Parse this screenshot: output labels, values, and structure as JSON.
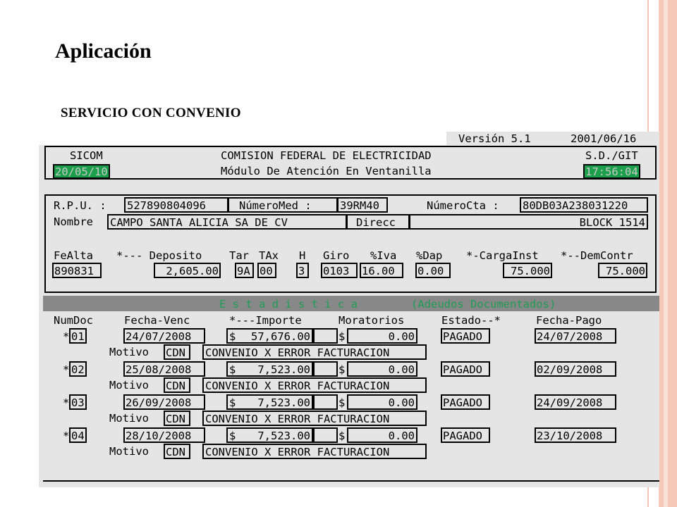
{
  "slide": {
    "title": "Aplicación",
    "subtitle": "SERVICIO CON CONVENIO"
  },
  "colors": {
    "slide_accent": "#f6c8b7",
    "terminal_bg": "#e5e5e5",
    "highlight_green": "#1b9f4a",
    "band_gray": "#888888"
  },
  "terminal": {
    "version": "Versión 5.1",
    "version_date": "2001/06/16",
    "system": "SICOM",
    "company": "COMISION FEDERAL DE ELECTRICIDAD",
    "dept": "S.D./GIT",
    "date": "20/05/10",
    "module": "Módulo De Atención En Ventanilla",
    "time": "17:56:04",
    "rpu_label": "R.P.U. :",
    "rpu": "527890804096",
    "num_med_label": "NúmeroMed :",
    "num_med": "39RM40",
    "num_cta_label": "NúmeroCta :",
    "num_cta": "80DB03A238031220",
    "nombre_label": "Nombre",
    "nombre": "CAMPO SANTA ALICIA SA DE CV",
    "direcc_label": "Direcc",
    "direcc": "BLOCK 1514",
    "account_headers": {
      "fealta": "FeAlta",
      "deposito": "*--- Deposito",
      "tar": "Tar",
      "tax": "TAx",
      "h": "H",
      "giro": "Giro",
      "iva": "%Iva",
      "dap": "%Dap",
      "carga": "*-CargaInst",
      "dem": "*--DemContr"
    },
    "account_values": {
      "fealta": "890831",
      "deposito": "2,605.00",
      "tar": "9A",
      "tax": "00",
      "h": "3",
      "giro": "0103",
      "iva": "16.00",
      "dap": "0.00",
      "carga": "75.000",
      "dem": "75.000"
    },
    "stats_title": "E s t a d i s t i c a",
    "stats_subtitle": "(Adeudos Documentados)",
    "table_headers": {
      "num_doc": "NumDoc",
      "fecha_venc": "Fecha-Venc",
      "importe": "*---Importe",
      "moratorios": "Moratorios",
      "estado": "Estado--*",
      "fecha_pago": "Fecha-Pago"
    },
    "motivo_label": "Motivo",
    "rows": [
      {
        "star": "*",
        "num": "01",
        "fecha_venc": "24/07/2008",
        "dollar1": "$",
        "importe": "57,676.00",
        "dollar2": "$",
        "moratorios": "0.00",
        "estado": "PAGADO",
        "fecha_pago": "24/07/2008",
        "motivo_code": "CDN",
        "motivo_text": "CONVENIO X ERROR FACTURACION"
      },
      {
        "star": "*",
        "num": "02",
        "fecha_venc": "25/08/2008",
        "dollar1": "$",
        "importe": "7,523.00",
        "dollar2": "$",
        "moratorios": "0.00",
        "estado": "PAGADO",
        "fecha_pago": "02/09/2008",
        "motivo_code": "CDN",
        "motivo_text": "CONVENIO X ERROR FACTURACION"
      },
      {
        "star": "*",
        "num": "03",
        "fecha_venc": "26/09/2008",
        "dollar1": "$",
        "importe": "7,523.00",
        "dollar2": "$",
        "moratorios": "0.00",
        "estado": "PAGADO",
        "fecha_pago": "24/09/2008",
        "motivo_code": "CDN",
        "motivo_text": "CONVENIO X ERROR FACTURACION"
      },
      {
        "star": "*",
        "num": "04",
        "fecha_venc": "28/10/2008",
        "dollar1": "$",
        "importe": "7,523.00",
        "dollar2": "$",
        "moratorios": "0.00",
        "estado": "PAGADO",
        "fecha_pago": "23/10/2008",
        "motivo_code": "CDN",
        "motivo_text": "CONVENIO X ERROR FACTURACION"
      }
    ]
  }
}
